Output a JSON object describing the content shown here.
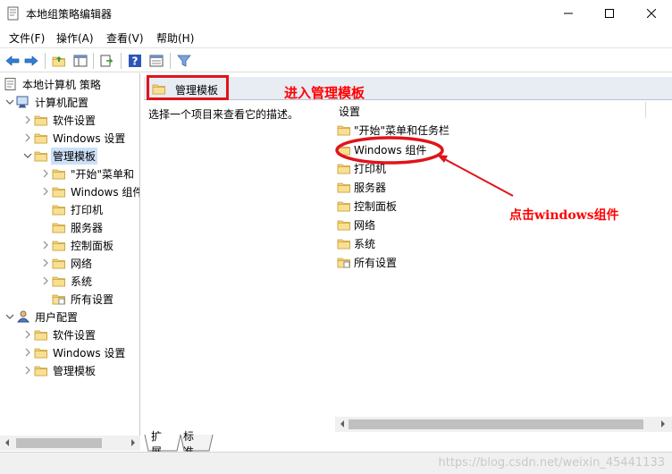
{
  "window": {
    "title": "本地组策略编辑器"
  },
  "menu": [
    "文件(F)",
    "操作(A)",
    "查看(V)",
    "帮助(H)"
  ],
  "tree": {
    "root": "本地计算机 策略",
    "computer_config": "计算机配置",
    "software_settings": "软件设置",
    "windows_settings": "Windows 设置",
    "admin_templates": "管理模板",
    "start_menu": "\"开始\"菜单和",
    "windows_components": "Windows 组件",
    "printers": "打印机",
    "servers": "服务器",
    "control_panel": "控制面板",
    "network": "网络",
    "system": "系统",
    "all_settings": "所有设置",
    "user_config": "用户配置",
    "u_software_settings": "软件设置",
    "u_windows_settings": "Windows 设置",
    "u_admin_templates": "管理模板"
  },
  "right": {
    "header_title": "管理模板",
    "description": "选择一个项目来查看它的描述。",
    "column_header": "设置",
    "items": [
      "\"开始\"菜单和任务栏",
      "Windows 组件",
      "打印机",
      "服务器",
      "控制面板",
      "网络",
      "系统",
      "所有设置"
    ]
  },
  "tabs": [
    "扩展",
    "标准"
  ],
  "annotations": {
    "enter_templates": "进入管理模板",
    "click_components": "点击windows组件"
  },
  "watermark": "https://blog.csdn.net/weixin_45441133",
  "colors": {
    "annotation": "#ff0000",
    "selection": "#cce0f7",
    "folder": "#f3d27a"
  }
}
